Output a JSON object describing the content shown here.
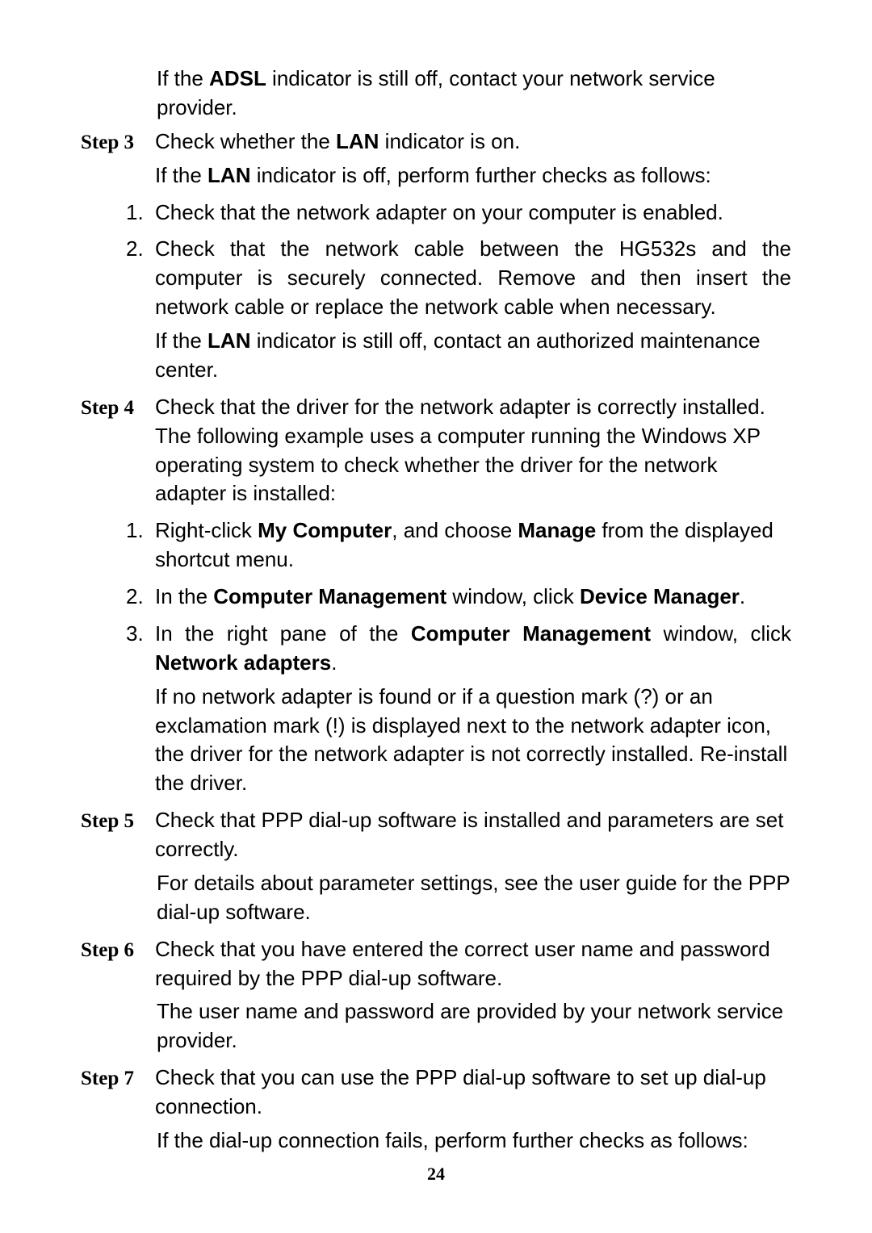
{
  "page_number": "24",
  "intro_para": {
    "pre": "If the ",
    "b1": "ADSL",
    "post": " indicator is still off, contact your network service provider."
  },
  "step3": {
    "label": "Step 3",
    "line1": {
      "pre": "Check whether the ",
      "b1": "LAN",
      "post": " indicator is on."
    },
    "line2": {
      "pre": "If the ",
      "b1": "LAN",
      "post": " indicator is off, perform further checks as follows:"
    },
    "item1_num": "1.",
    "item1": "Check that the network adapter on your computer is enabled.",
    "item2_num": "2.",
    "item2a": "Check that the network cable between the HG532s and the computer is securely connected. Remove and then insert the network cable or replace the network cable when necessary.",
    "item2b": {
      "pre": "If the ",
      "b1": "LAN",
      "post": " indicator is still off, contact an authorized maintenance center."
    }
  },
  "step4": {
    "label": "Step 4",
    "line1": "Check that the driver for the network adapter is correctly installed. The following example uses a computer running the Windows XP operating system to check whether the driver for the network adapter is installed:",
    "item1_num": "1.",
    "item1": {
      "pre": "Right-click ",
      "b1": "My Computer",
      "mid": ", and choose ",
      "b2": "Manage",
      "post": " from the displayed shortcut menu."
    },
    "item2_num": "2.",
    "item2": {
      "pre": "In the ",
      "b1": "Computer Management",
      "mid": " window, click ",
      "b2": "Device Manager",
      "post": "."
    },
    "item3_num": "3.",
    "item3a": {
      "pre": "In the right pane of the ",
      "b1": "Computer Management",
      "mid": " window, click ",
      "b2": "Network adapters",
      "post": "."
    },
    "item3b": "If no network adapter is found or if a question mark (?) or an exclamation mark (!) is displayed next to the network adapter icon, the driver for the network adapter is not correctly installed. Re-install the driver."
  },
  "step5": {
    "label": "Step 5",
    "line1": "Check that PPP dial-up software is installed and parameters are set correctly.",
    "line2": "For details about parameter settings, see the user guide for the PPP dial-up software."
  },
  "step6": {
    "label": "Step 6",
    "line1": "Check that you have entered the correct user name and password required by the PPP dial-up software.",
    "line2": "The user name and password are provided by your network service provider."
  },
  "step7": {
    "label": "Step 7",
    "line1": "Check that you can use the PPP dial-up software to set up dial-up connection.",
    "line2": "If the dial-up connection fails, perform further checks as follows:"
  }
}
